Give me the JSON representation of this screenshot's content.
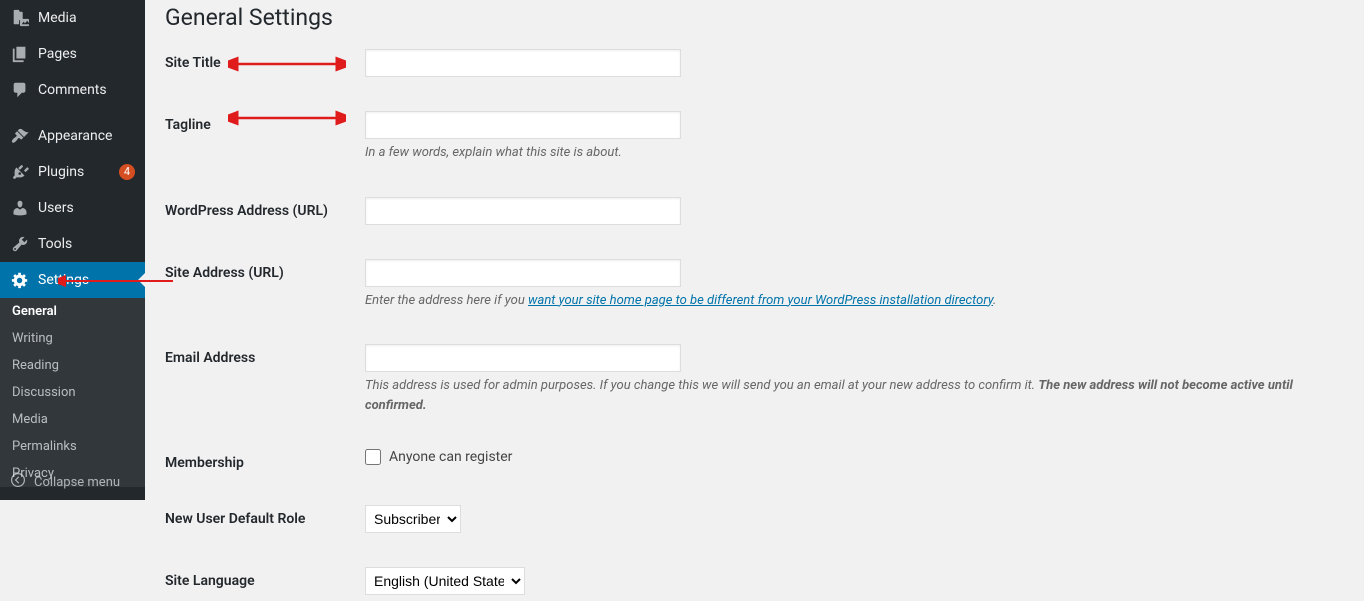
{
  "sidebar": {
    "items": [
      {
        "label": "Media",
        "icon": "media-icon"
      },
      {
        "label": "Pages",
        "icon": "page-icon"
      },
      {
        "label": "Comments",
        "icon": "comments-icon"
      },
      {
        "label": "Appearance",
        "icon": "appearance-icon"
      },
      {
        "label": "Plugins",
        "icon": "plugins-icon",
        "badge": "4"
      },
      {
        "label": "Users",
        "icon": "users-icon"
      },
      {
        "label": "Tools",
        "icon": "tools-icon"
      },
      {
        "label": "Settings",
        "icon": "settings-icon",
        "current": true
      }
    ],
    "submenu": [
      {
        "label": "General",
        "active": true
      },
      {
        "label": "Writing"
      },
      {
        "label": "Reading"
      },
      {
        "label": "Discussion"
      },
      {
        "label": "Media"
      },
      {
        "label": "Permalinks"
      },
      {
        "label": "Privacy"
      }
    ],
    "collapse_label": "Collapse menu"
  },
  "page": {
    "title": "General Settings"
  },
  "form": {
    "site_title": {
      "label": "Site Title",
      "value": ""
    },
    "tagline": {
      "label": "Tagline",
      "value": "",
      "description": "In a few words, explain what this site is about."
    },
    "wp_address": {
      "label": "WordPress Address (URL)",
      "value": ""
    },
    "site_address": {
      "label": "Site Address (URL)",
      "value": "",
      "description_prefix": "Enter the address here if you ",
      "description_link": "want your site home page to be different from your WordPress installation directory",
      "description_suffix": "."
    },
    "email": {
      "label": "Email Address",
      "value": "",
      "description_prefix": "This address is used for admin purposes. If you change this we will send you an email at your new address to confirm it. ",
      "description_bold": "The new address will not become active until confirmed."
    },
    "membership": {
      "label": "Membership",
      "checkbox_label": "Anyone can register"
    },
    "default_role": {
      "label": "New User Default Role",
      "value": "Subscriber"
    },
    "site_language": {
      "label": "Site Language",
      "value": "English (United States)"
    }
  }
}
